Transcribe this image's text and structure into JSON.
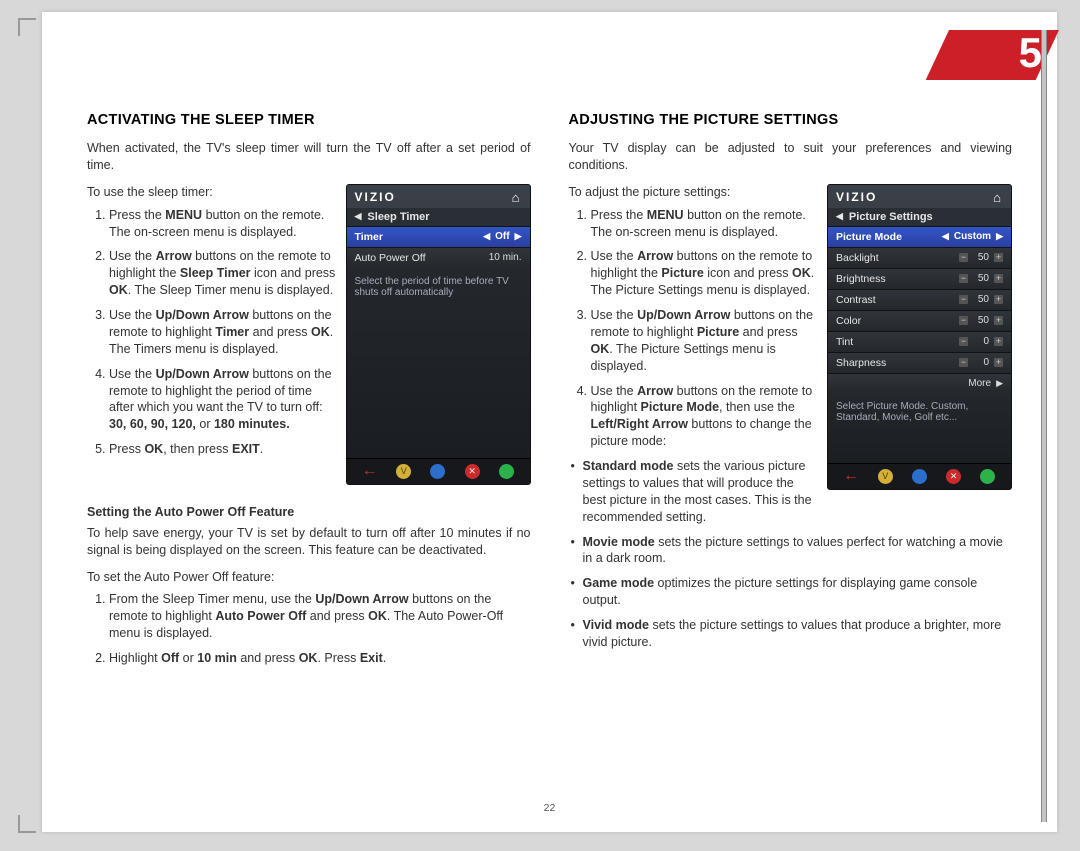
{
  "chapter": "5",
  "page_number": "22",
  "left": {
    "heading": "ACTIVATING THE SLEEP TIMER",
    "intro": "When activated, the TV's sleep timer will turn the TV off after a set period of time.",
    "lead": "To use the sleep timer:",
    "steps": [
      "Press the <b>MENU</b> button on the remote. The on-screen menu is displayed.",
      "Use the <b>Arrow</b> buttons on the remote to highlight the <b>Sleep Timer</b> icon and press <b>OK</b>. The Sleep Timer menu is displayed.",
      "Use the <b>Up/Down Arrow</b> buttons on the remote to highlight <b>Timer</b> and press <b>OK</b>. The Timers menu is displayed.",
      "Use the <b>Up/Down Arrow</b> buttons on the remote to highlight the period of time after which you want the TV to turn off: <b>30, 60, 90, 120,</b> or <b>180 minutes.</b>",
      "Press <b>OK</b>, then press <b>EXIT</b>."
    ],
    "sub_heading": "Setting the Auto Power Off Feature",
    "sub_intro": "To help save energy, your TV is set by default to turn off after 10 minutes if no signal is being displayed on the screen. This feature can be deactivated.",
    "sub_lead": "To set the Auto Power Off feature:",
    "sub_steps": [
      "From the Sleep Timer menu, use the <b>Up/Down Arrow</b> buttons on the remote to highlight <b>Auto Power Off</b> and press <b>OK</b>. The Auto Power-Off menu is displayed.",
      "Highlight <b>Off</b> or <b>10 min</b> and press <b>OK</b>. Press <b>Exit</b>."
    ],
    "tv": {
      "brand": "VIZIO",
      "crumb": "Sleep Timer",
      "rows": [
        {
          "label": "Timer",
          "value": "Off",
          "selected": true,
          "arrows": true
        },
        {
          "label": "Auto Power Off",
          "value": "10 min.",
          "selected": false
        }
      ],
      "hint": "Select the period of time before TV shuts off automatically"
    }
  },
  "right": {
    "heading": "ADJUSTING THE PICTURE SETTINGS",
    "intro": "Your TV display can be adjusted to suit your preferences and viewing conditions.",
    "lead": "To adjust the picture settings:",
    "steps": [
      "Press the <b>MENU</b> button on the remote. The on-screen menu is displayed.",
      "Use the <b>Arrow</b> buttons on the remote to highlight the <b>Picture</b> icon and press <b>OK</b>. The Picture Settings menu is displayed.",
      "Use the <b>Up/Down Arrow</b> buttons on the remote to highlight <b>Picture</b> and press <b>OK</b>. The Picture Settings menu is displayed.",
      "Use the <b>Arrow</b> buttons on the remote to highlight <b>Picture Mode</b>, then use the <b>Left/Right Arrow</b> buttons to change the picture mode:"
    ],
    "modes": [
      "<b>Standard mode</b> sets the various picture settings to values that will produce the best picture in the most cases. This is the recommended setting.",
      "<b>Movie mode</b> sets the picture settings to values perfect for watching a movie in a dark room.",
      "<b>Game mode</b> optimizes the picture settings for displaying game console output.",
      "<b>Vivid mode</b> sets the picture settings to values that produce a brighter, more vivid picture."
    ],
    "tv": {
      "brand": "VIZIO",
      "crumb": "Picture Settings",
      "rows": [
        {
          "label": "Picture Mode",
          "value": "Custom",
          "selected": true,
          "arrows": true
        },
        {
          "label": "Backlight",
          "value": "50",
          "slider": true
        },
        {
          "label": "Brightness",
          "value": "50",
          "slider": true
        },
        {
          "label": "Contrast",
          "value": "50",
          "slider": true
        },
        {
          "label": "Color",
          "value": "50",
          "slider": true
        },
        {
          "label": "Tint",
          "value": "0",
          "slider": true
        },
        {
          "label": "Sharpness",
          "value": "0",
          "slider": true
        }
      ],
      "more": "More",
      "hint": "Select Picture Mode. Custom, Standard, Movie, Golf etc..."
    }
  }
}
